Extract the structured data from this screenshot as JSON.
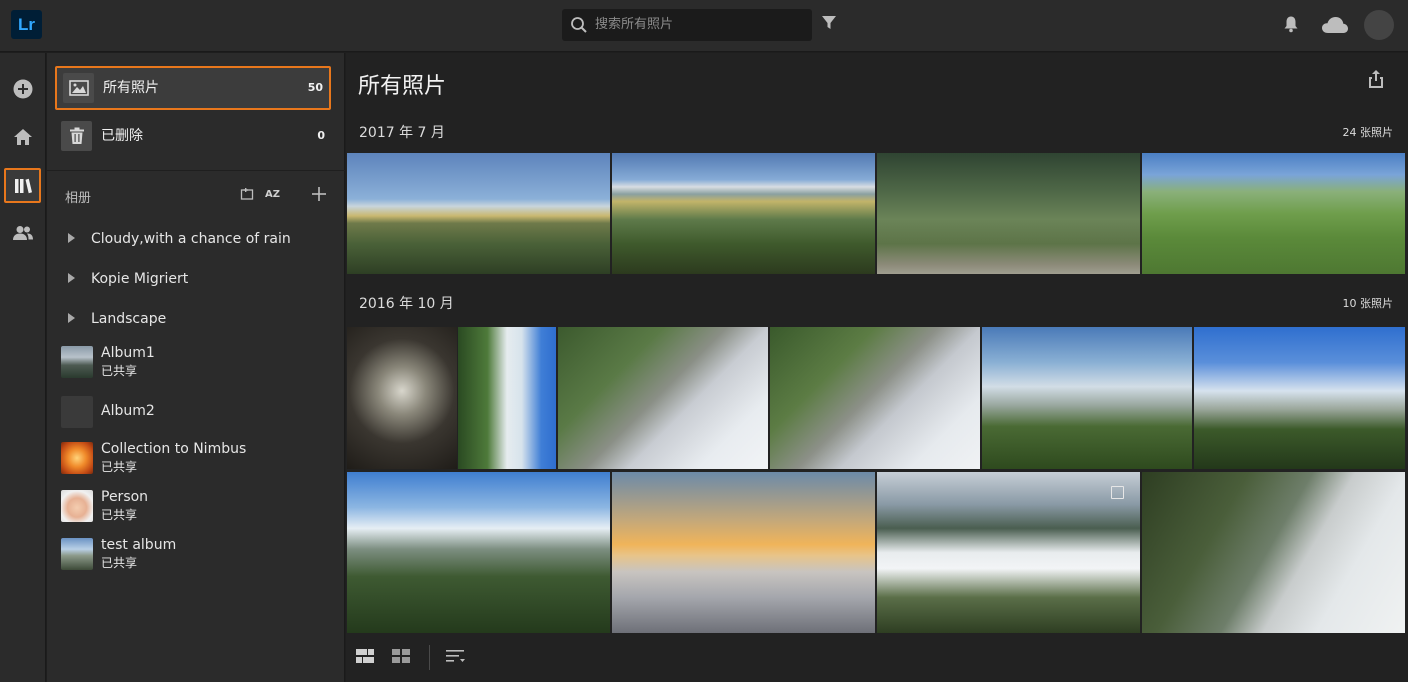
{
  "app": {
    "logo_text": "Lr"
  },
  "search": {
    "placeholder": "搜索所有照片"
  },
  "panel": {
    "all_photos": {
      "label": "所有照片",
      "count": "50"
    },
    "deleted": {
      "label": "已删除",
      "count": "0"
    },
    "albums_section": {
      "title": "相册",
      "sort_label": "AZ"
    },
    "folders": [
      {
        "label": "Cloudy,with a chance of rain"
      },
      {
        "label": "Kopie Migriert"
      },
      {
        "label": "Landscape"
      }
    ],
    "albums": [
      {
        "name": "Album1",
        "shared": "已共享"
      },
      {
        "name": "Album2",
        "shared": ""
      },
      {
        "name": "Collection to Nimbus",
        "shared": "已共享"
      },
      {
        "name": "Person",
        "shared": "已共享"
      },
      {
        "name": "test album",
        "shared": "已共享"
      }
    ]
  },
  "main": {
    "title": "所有照片",
    "groups": [
      {
        "date": "2017 年 7 月",
        "count": "24 张照片"
      },
      {
        "date": "2016 年 10 月",
        "count": "10 张照片"
      }
    ]
  },
  "colors": {
    "accent": "#e8771c",
    "lr_blue": "#31a8ff",
    "lr_bg": "#001e36"
  }
}
